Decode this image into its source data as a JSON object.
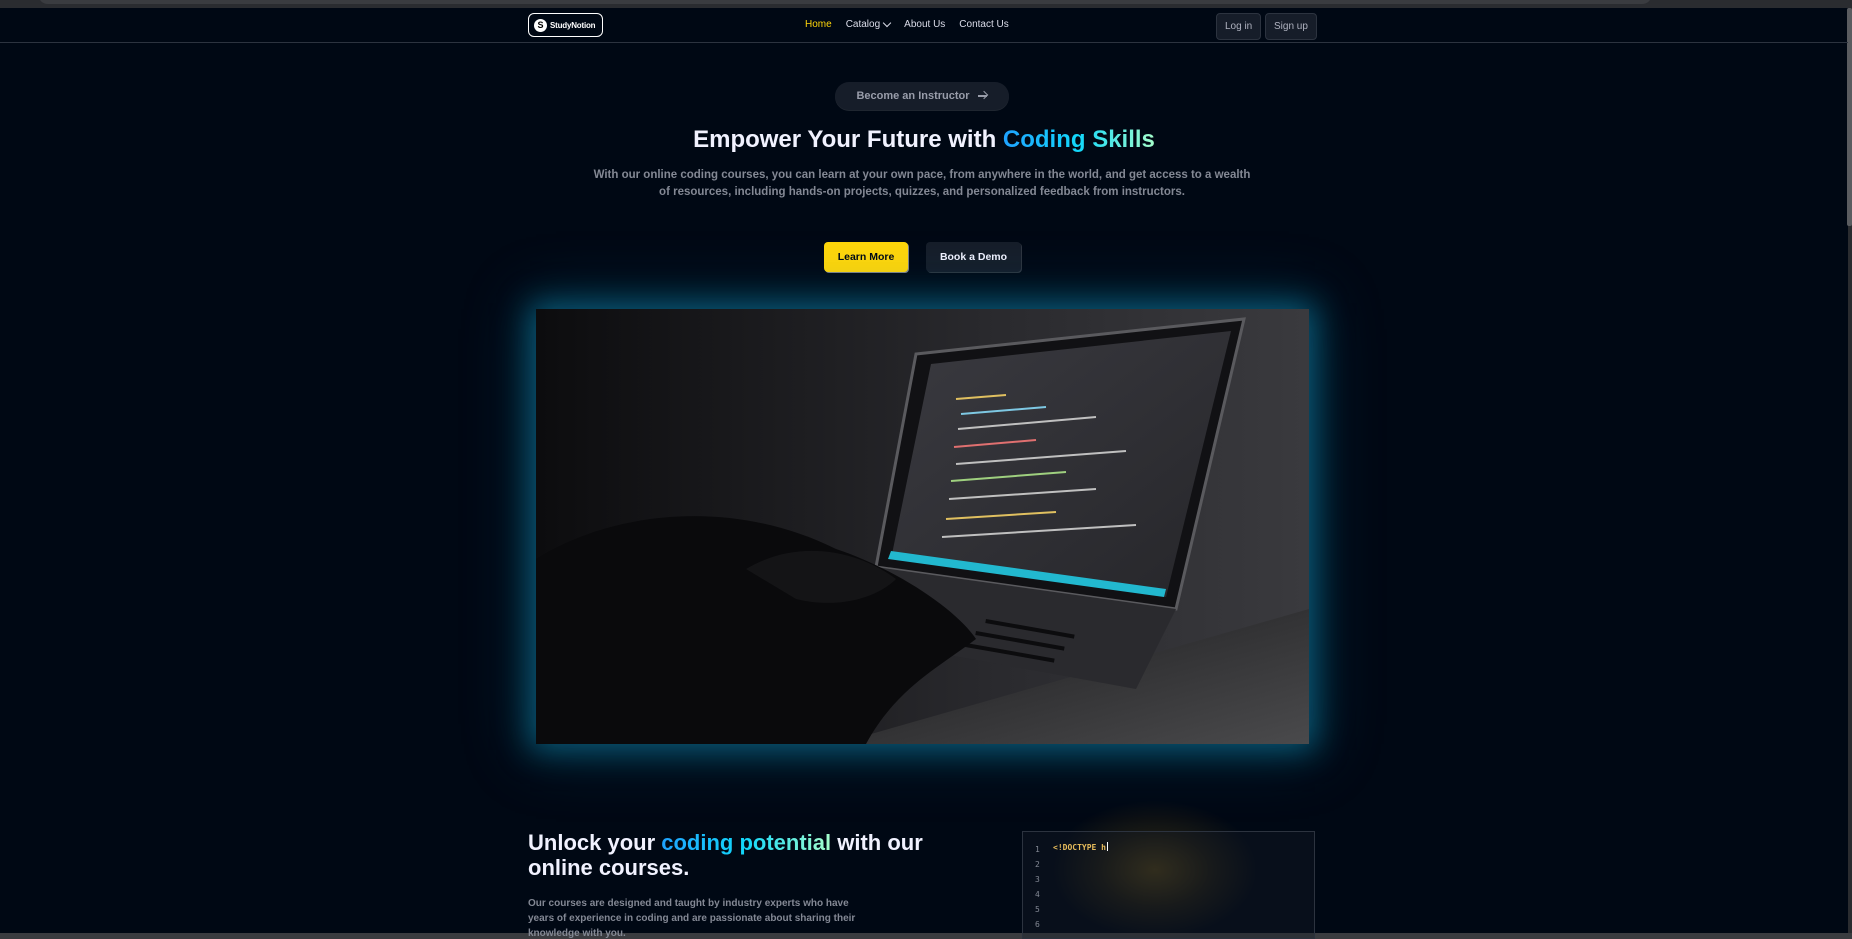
{
  "navbar": {
    "logo_text": "StudyNotion",
    "logo_mark": "S",
    "links": [
      {
        "label": "Home",
        "active": true
      },
      {
        "label": "Catalog",
        "has_dropdown": true
      },
      {
        "label": "About Us"
      },
      {
        "label": "Contact Us"
      }
    ],
    "login_label": "Log in",
    "signup_label": "Sign up"
  },
  "hero": {
    "instructor_pill": "Become an Instructor",
    "title_prefix": "Empower Your Future with ",
    "title_highlight": "Coding Skills",
    "subtitle": "With our online coding courses, you can learn at your own pace, from anywhere in the world, and get access to a wealth of resources, including hands-on projects, quizzes, and personalized feedback from instructors.",
    "learn_more_label": "Learn More",
    "book_demo_label": "Book a Demo"
  },
  "section2": {
    "title_prefix": "Unlock your ",
    "title_highlight": "coding potential",
    "title_suffix": " with our online courses.",
    "description": "Our courses are designed and taught by industry experts who have years of experience in coding and are passionate about sharing their knowledge with you."
  },
  "code_block": {
    "line_numbers": [
      "1",
      "2",
      "3",
      "4",
      "5",
      "6"
    ],
    "typed_text": "<!DOCTYPE h"
  },
  "colors": {
    "background": "#000814",
    "accent_yellow": "#FFD60A",
    "accent_cyan": "#22D3EE",
    "muted_text": "#838894"
  }
}
